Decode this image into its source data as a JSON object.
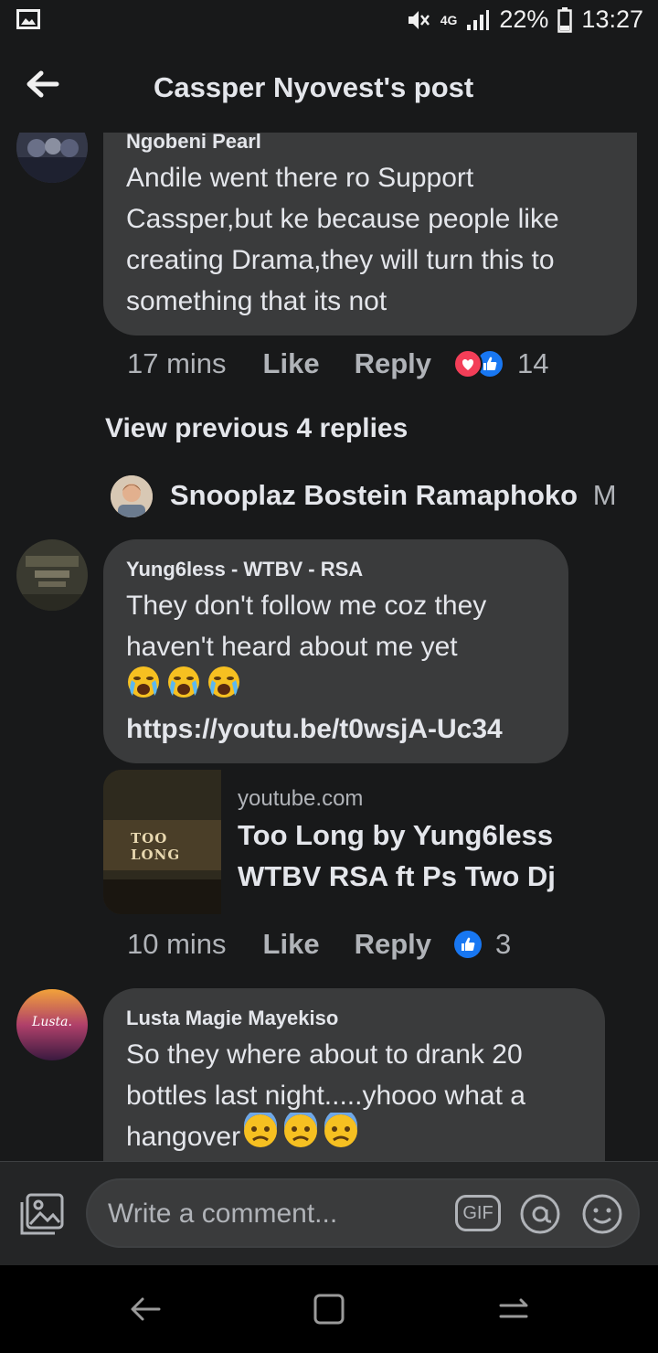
{
  "status_bar": {
    "network": "4G",
    "battery": "22%",
    "time": "13:27"
  },
  "header": {
    "title": "Cassper Nyovest's post"
  },
  "comments": [
    {
      "author": "Ngobeni Pearl",
      "lines": [
        "Andile went there ro Support",
        "Cassper,but ke because people like",
        "creating Drama,they will turn this to",
        "something that its not"
      ],
      "time": "17 mins",
      "like_label": "Like",
      "reply_label": "Reply",
      "reaction_count": "14"
    },
    {
      "author": "Yung6less - WTBV - RSA",
      "lines": [
        "They don't follow me coz they",
        "haven't heard about me yet"
      ],
      "link": "https://youtu.be/t0wsjA-Uc34",
      "preview": {
        "domain": "youtube.com",
        "title_line1": "Too Long by Yung6less",
        "title_line2": "WTBV RSA ft Ps Two Dj",
        "thumb_text": "TOO LONG"
      },
      "time": "10 mins",
      "like_label": "Like",
      "reply_label": "Reply",
      "reaction_count": "3"
    },
    {
      "author": "Lusta Magie Mayekiso",
      "avatar_text": "Lusta.",
      "lines": [
        "So they where about to drank 20",
        "bottles last night.....yhooo what a"
      ],
      "last_line": "hangover"
    }
  ],
  "view_previous": "View previous 4 replies",
  "reply_preview": {
    "author": "Snooplaz Bostein Ramaphoko",
    "snippet": "M"
  },
  "composer": {
    "placeholder": "Write a comment...",
    "gif_label": "GIF"
  },
  "colors": {
    "bubble": "#3a3b3c",
    "background": "#18191a",
    "like_blue": "#1877f2",
    "love_red": "#f33e58"
  }
}
